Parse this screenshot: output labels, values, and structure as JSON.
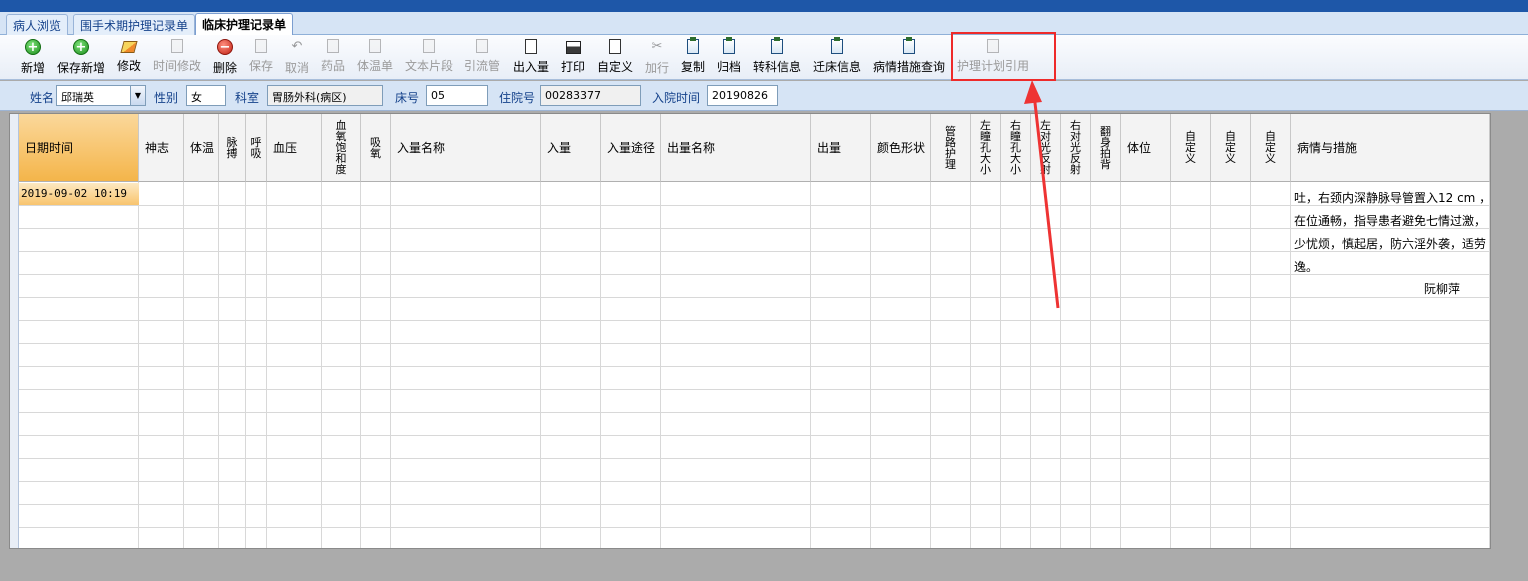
{
  "tabs": [
    "病人浏览",
    "围手术期护理记录单",
    "临床护理记录单"
  ],
  "toolbar": [
    {
      "label": "新增",
      "icon": "add-icon",
      "enabled": true
    },
    {
      "label": "保存新增",
      "icon": "save-add-icon",
      "enabled": true
    },
    {
      "label": "修改",
      "icon": "edit-icon",
      "enabled": true
    },
    {
      "label": "时间修改",
      "icon": "time-edit-icon",
      "enabled": false
    },
    {
      "label": "删除",
      "icon": "delete-icon",
      "enabled": true
    },
    {
      "label": "保存",
      "icon": "save-icon",
      "enabled": false
    },
    {
      "label": "取消",
      "icon": "undo-icon",
      "enabled": false
    },
    {
      "label": "药品",
      "icon": "drug-icon",
      "enabled": false
    },
    {
      "label": "体温单",
      "icon": "temperature-sheet-icon",
      "enabled": false
    },
    {
      "label": "文本片段",
      "icon": "text-snippet-icon",
      "enabled": false
    },
    {
      "label": "引流管",
      "icon": "drainage-icon",
      "enabled": false
    },
    {
      "label": "出入量",
      "icon": "intake-output-icon",
      "enabled": true
    },
    {
      "label": "打印",
      "icon": "printer-icon",
      "enabled": true
    },
    {
      "label": "自定义",
      "icon": "custom-doc-icon",
      "enabled": true
    },
    {
      "label": "加行",
      "icon": "add-row-icon",
      "enabled": false
    },
    {
      "label": "复制",
      "icon": "copy-icon",
      "enabled": true
    },
    {
      "label": "归档",
      "icon": "archive-icon",
      "enabled": true
    },
    {
      "label": "转科信息",
      "icon": "transfer-dept-icon",
      "enabled": true
    },
    {
      "label": "迁床信息",
      "icon": "bed-transfer-icon",
      "enabled": true
    },
    {
      "label": "病情措施查询",
      "icon": "condition-query-icon",
      "enabled": true
    },
    {
      "label": "护理计划引用",
      "icon": "nursing-plan-icon",
      "enabled": false
    }
  ],
  "patient": {
    "name_label": "姓名",
    "name_value": "邱瑞英",
    "gender_label": "性别",
    "gender_value": "女",
    "dept_label": "科室",
    "dept_value": "胃肠外科(病区)",
    "bed_label": "床号",
    "bed_value": "05",
    "inpatient_label": "住院号",
    "inpatient_value": "00283377",
    "admission_label": "入院时间",
    "admission_value": "20190826"
  },
  "grid": {
    "columns": [
      "日期时间",
      "神志",
      "体温",
      "脉搏",
      "呼吸",
      "血压",
      "血氧饱和度",
      "吸氧",
      "入量名称",
      "入量",
      "入量途径",
      "出量名称",
      "出量",
      "颜色形状",
      "管路护理",
      "左瞳孔大小",
      "右瞳孔大小",
      "左对光反射",
      "右对光反射",
      "翻身拍背",
      "体位",
      "自定义",
      "自定义",
      "自定义",
      "病情与措施"
    ],
    "rows": [
      {
        "datetime": "2019-09-02 10:19"
      }
    ],
    "notes": [
      "吐，右颈内深静脉导管置入12 cm ，",
      "在位通畅，指导患者避免七情过激，",
      "少忧烦，慎起居，防六淫外袭，适劳",
      "逸。"
    ],
    "signature": "阮柳萍"
  }
}
